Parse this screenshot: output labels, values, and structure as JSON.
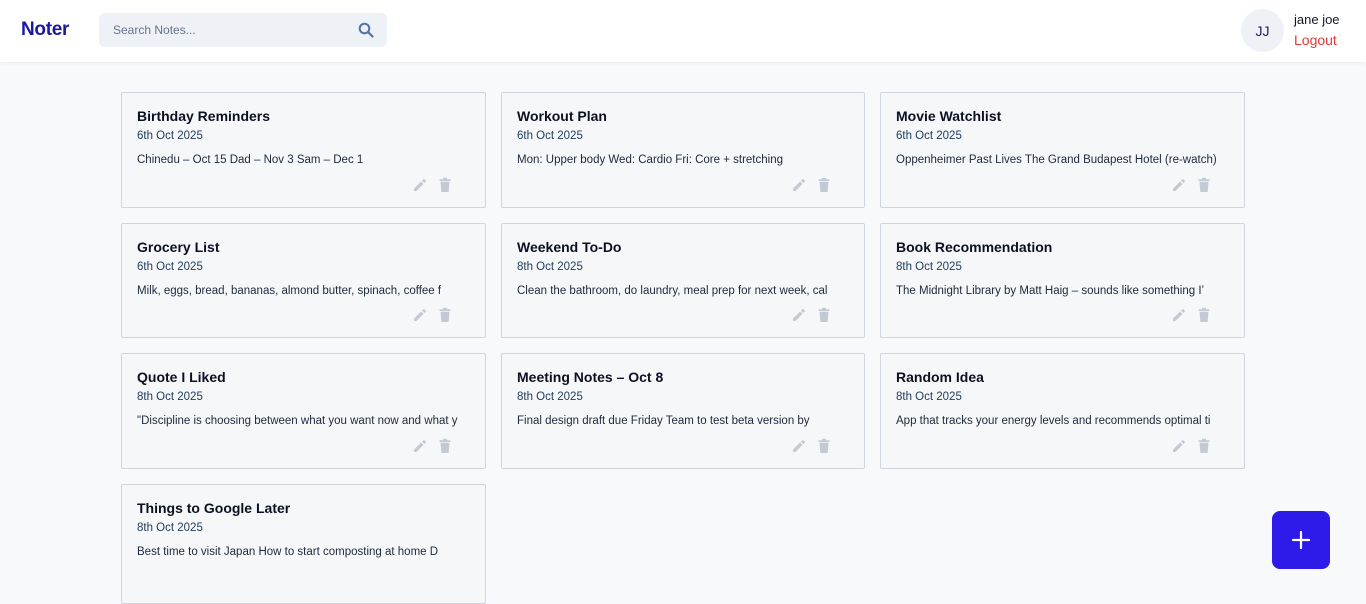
{
  "app": {
    "name": "Noter"
  },
  "search": {
    "placeholder": "Search Notes...",
    "value": ""
  },
  "user": {
    "initials": "JJ",
    "name": "jane joe",
    "logout_label": "Logout"
  },
  "colors": {
    "brand": "#1d18a0",
    "accent": "#2d1ae8",
    "logout": "#e53935",
    "icon_muted": "#c3cad3"
  },
  "icons": {
    "search": "search-icon",
    "edit": "pencil-icon",
    "delete": "trash-icon",
    "add": "plus-icon"
  },
  "notes": [
    {
      "title": "Birthday Reminders",
      "date": "6th Oct 2025",
      "body": "Chinedu – Oct 15 Dad – Nov 3 Sam – Dec 1"
    },
    {
      "title": "Workout Plan",
      "date": "6th Oct 2025",
      "body": "Mon: Upper body Wed: Cardio Fri: Core + stretching"
    },
    {
      "title": "Movie Watchlist",
      "date": "6th Oct 2025",
      "body": "Oppenheimer Past Lives The Grand Budapest Hotel (re-watch)"
    },
    {
      "title": "Grocery List",
      "date": "6th Oct 2025",
      "body": "Milk, eggs, bread, bananas, almond butter, spinach, coffee f"
    },
    {
      "title": "Weekend To-Do",
      "date": "8th Oct 2025",
      "body": "Clean the bathroom, do laundry, meal prep for next week, cal"
    },
    {
      "title": "Book Recommendation",
      "date": "8th Oct 2025",
      "body": "The Midnight Library by Matt Haig – sounds like something I’"
    },
    {
      "title": "Quote I Liked",
      "date": "8th Oct 2025",
      "body": "\"Discipline is choosing between what you want now and what y"
    },
    {
      "title": "Meeting Notes – Oct 8",
      "date": "8th Oct 2025",
      "body": "Final design draft due Friday Team to test beta version by"
    },
    {
      "title": "Random Idea",
      "date": "8th Oct 2025",
      "body": "App that tracks your energy levels and recommends optimal ti"
    },
    {
      "title": "Things to Google Later",
      "date": "8th Oct 2025",
      "body": "Best time to visit Japan How to start composting at home D"
    }
  ]
}
